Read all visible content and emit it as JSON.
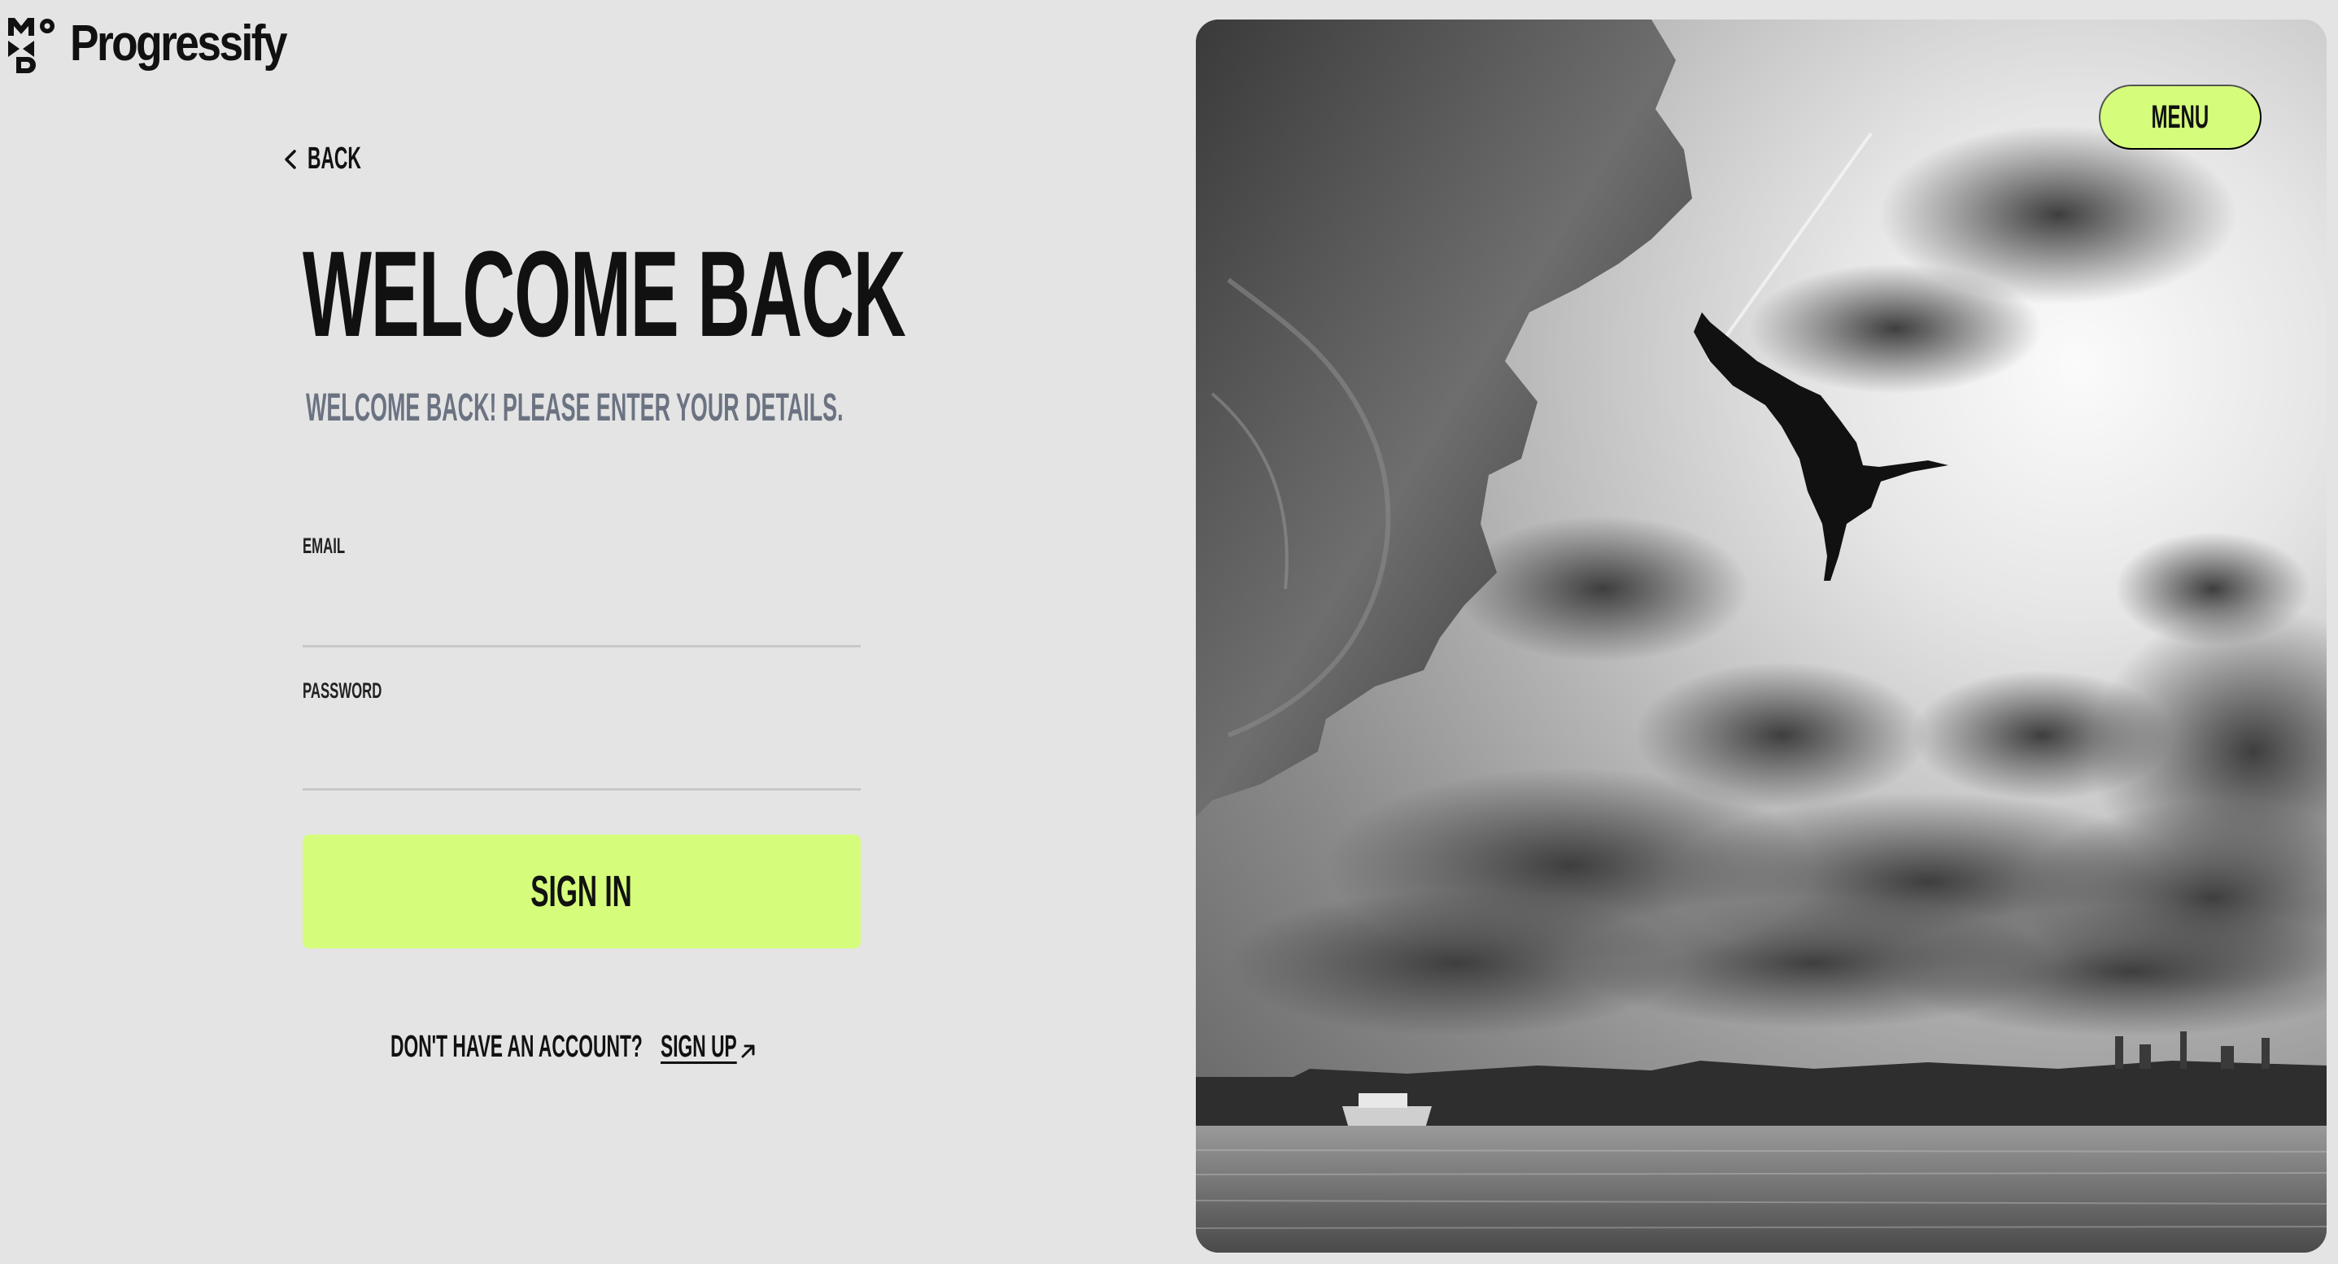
{
  "brand": {
    "name": "Progressify",
    "mark_letters": "MOD"
  },
  "nav": {
    "back_label": "Back",
    "menu_label": "Menu"
  },
  "form": {
    "title": "Welcome back",
    "subtitle": "Welcome back! Please enter your details.",
    "email_label": "Email",
    "email_value": "",
    "password_label": "Password",
    "password_value": "",
    "submit_label": "Sign in"
  },
  "footer": {
    "prompt": "Don't have an account?",
    "signup_label": "Sign up"
  },
  "colors": {
    "accent": "#d5fd7b",
    "background": "#e4e4e4",
    "text": "#111111",
    "muted": "#6b7382"
  },
  "icons": [
    "chevron-left-icon",
    "arrow-up-right-icon"
  ],
  "photo": {
    "subject": "cliff-diver-photo"
  }
}
